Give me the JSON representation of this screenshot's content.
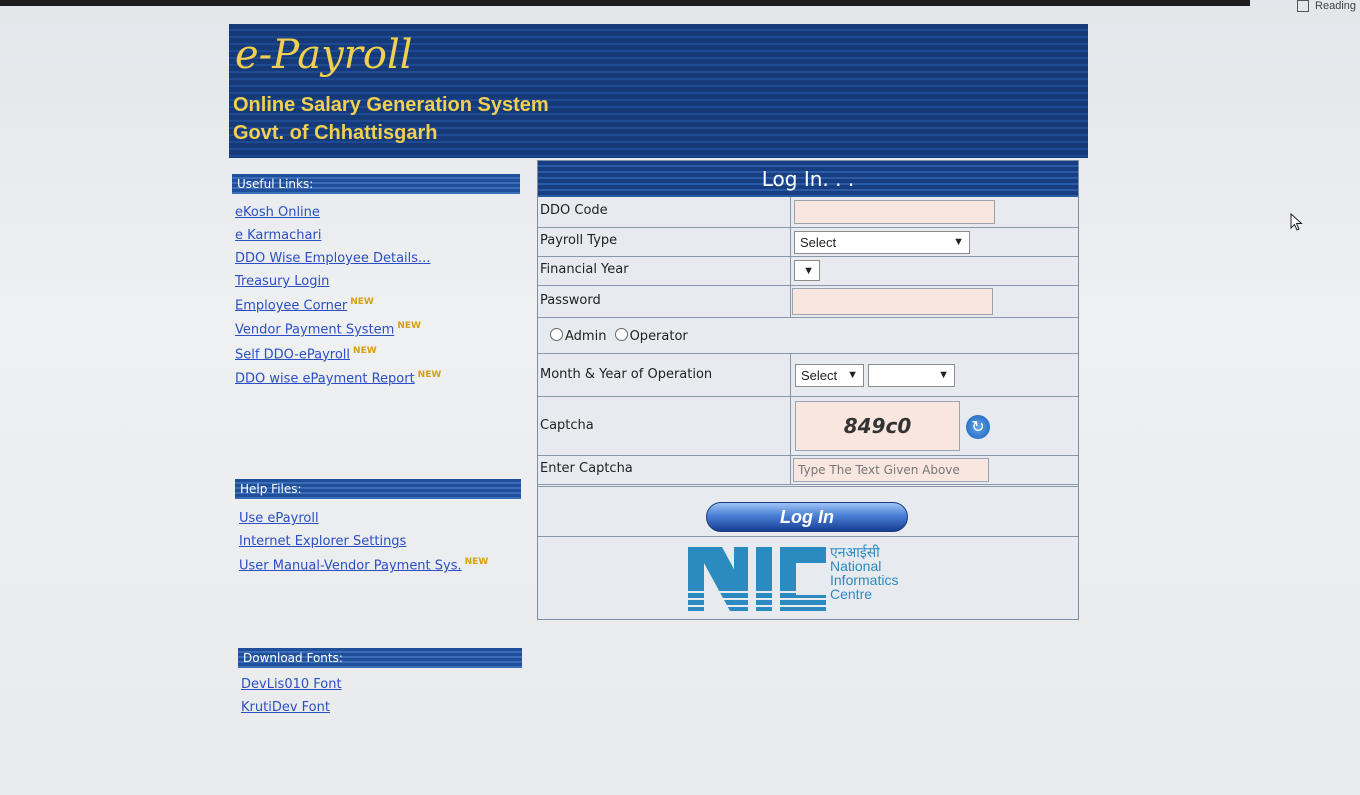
{
  "header": {
    "logo": "e-Payroll",
    "subtitle1": "Online Salary Generation System",
    "subtitle2": "Govt. of Chhattisgarh"
  },
  "browser": {
    "reading_label": "Reading"
  },
  "useful_links": {
    "title": "Useful Links:",
    "items": [
      {
        "label": "eKosh Online",
        "new": ""
      },
      {
        "label": "e Karmachari",
        "new": ""
      },
      {
        "label": "DDO Wise Employee Details...",
        "new": ""
      },
      {
        "label": "Treasury Login",
        "new": ""
      },
      {
        "label": "Employee Corner",
        "new": "NEW"
      },
      {
        "label": "Vendor Payment System",
        "new": "NEW"
      },
      {
        "label": "Self DDO-ePayroll",
        "new": "NEW"
      },
      {
        "label": "DDO wise ePayment Report",
        "new": "NEW"
      }
    ]
  },
  "help_files": {
    "title": "Help Files:",
    "items": [
      {
        "label": "Use ePayroll",
        "new": ""
      },
      {
        "label": "Internet Explorer Settings",
        "new": ""
      },
      {
        "label": "User Manual-Vendor Payment Sys.",
        "new": "NEW"
      }
    ]
  },
  "download_fonts": {
    "title": "Download Fonts:",
    "items": [
      {
        "label": "DevLis010 Font"
      },
      {
        "label": "KrutiDev Font"
      }
    ]
  },
  "login": {
    "title": "Log In. . .",
    "ddo_code_label": "DDO Code",
    "ddo_code_value": "",
    "payroll_type_label": "Payroll Type",
    "payroll_type_value": "Select",
    "financial_year_label": "Financial Year",
    "financial_year_value": "",
    "password_label": "Password",
    "password_value": "",
    "role_admin": "Admin",
    "role_operator": "Operator",
    "month_year_label": "Month & Year of Operation",
    "month_value": "Select",
    "year_value": "",
    "captcha_label": "Captcha",
    "captcha_text": "849c0",
    "enter_captcha_label": "Enter Captcha",
    "enter_captcha_placeholder": "Type The Text Given Above",
    "login_button": "Log In"
  },
  "nic": {
    "abbr": "NIC",
    "hindi": "एनआईसी",
    "line1": "National",
    "line2": "Informatics",
    "line3": "Centre"
  },
  "colors": {
    "banner_blue": "#163a78",
    "title_gold": "#f1cf4f",
    "link_blue": "#2c4fc4",
    "new_badge": "#d8a010",
    "nic_blue": "#2b8bc0"
  }
}
